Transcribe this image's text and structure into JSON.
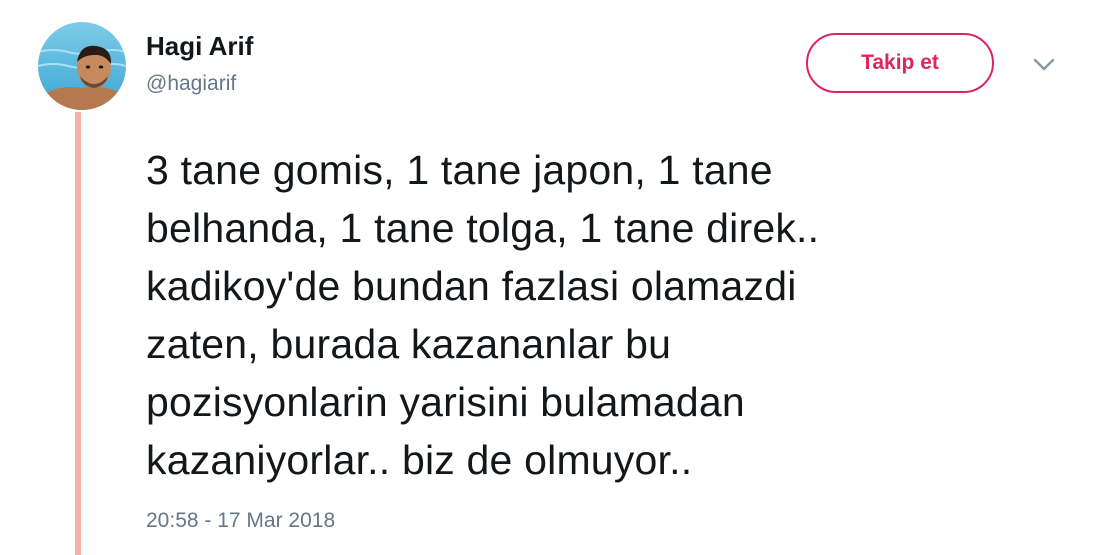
{
  "user": {
    "display_name": "Hagi Arif",
    "username": "@hagiarif"
  },
  "actions": {
    "follow_label": "Takip et",
    "more_icon": "chevron-down-icon"
  },
  "tweet": {
    "text": "3 tane gomis, 1 tane japon, 1 tane\nbelhanda, 1 tane tolga, 1 tane direk..\nkadikoy'de bundan fazlasi olamazdi\nzaten, burada kazananlar bu\npozisyonlarin yarisini bulamadan\nkazaniyorlar.. biz de olmuyor..",
    "timestamp": "20:58 - 17 Mar 2018"
  },
  "colors": {
    "accent": "#e0245e",
    "thread_line": "#f5b0a8",
    "secondary_text": "#657786",
    "primary_text": "#14171a"
  }
}
